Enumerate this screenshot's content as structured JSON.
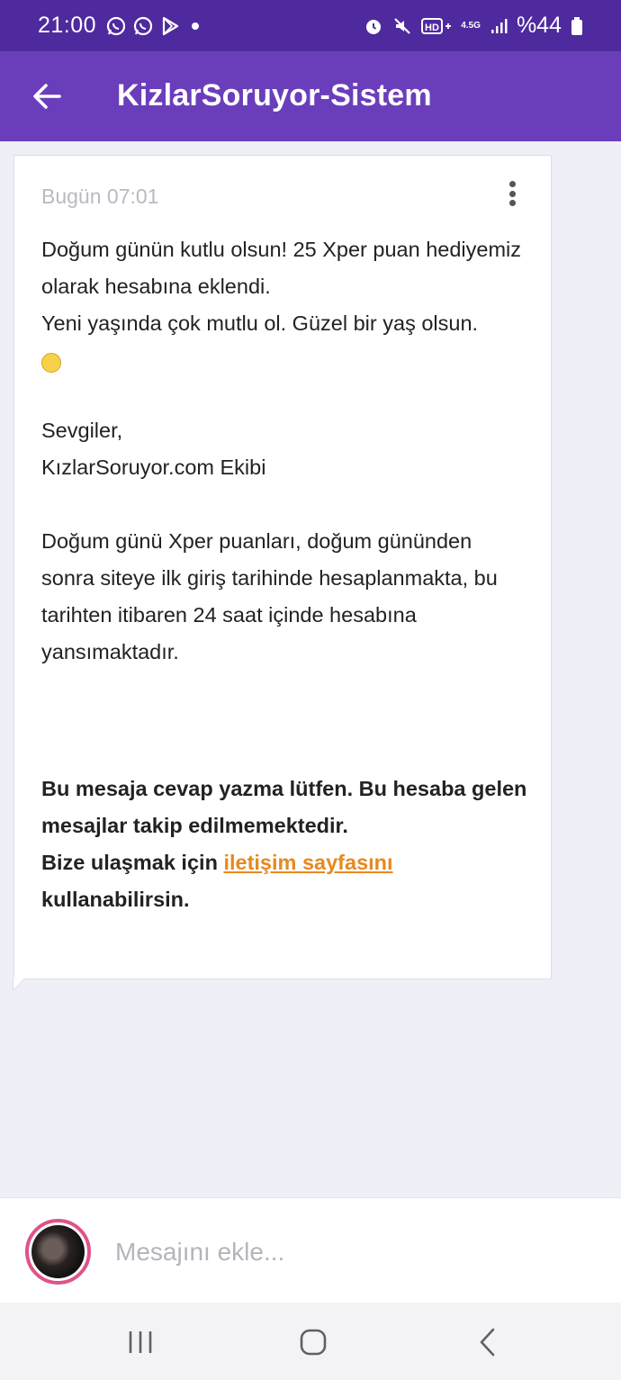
{
  "status_bar": {
    "time": "21:00",
    "battery": "%44",
    "network": "4.5G",
    "icons": [
      "whatsapp-icon",
      "whatsapp-icon",
      "play-store-icon",
      "dot-icon",
      "alarm-icon",
      "mute-icon",
      "hd-plus-icon",
      "network-4.5g-icon",
      "signal-icon",
      "battery-icon"
    ]
  },
  "app_bar": {
    "title": "KizlarSoruyor-Sistem",
    "back_icon": "arrow-left-icon"
  },
  "message": {
    "time": "Bugün 07:01",
    "menu_icon": "more-vertical-icon",
    "paragraph1": {
      "line1": "Doğum günün kutlu olsun! 25 Xper puan hediyemiz olarak hesabına eklendi.",
      "line2": "Yeni yaşında çok mutlu ol. Güzel bir yaş olsun.",
      "emoji": "smiling-face-emoji"
    },
    "signoff": {
      "line1": "Sevgiler,",
      "line2": "KızlarSoruyor.com Ekibi"
    },
    "paragraph2": "Doğum günü Xper puanları, doğum gününden sonra siteye ilk giriş tarihinde hesaplanmakta, bu tarihten itibaren 24 saat içinde hesabına yansımaktadır.",
    "notice": {
      "line1": "Bu mesaja cevap yazma lütfen. Bu hesaba gelen mesajlar takip edilmemektedir.",
      "line2_prefix": "Bize ulaşmak için",
      "link_text": "iletişim sayfasını",
      "line2_suffix": "kullanabilirsin."
    }
  },
  "composer": {
    "placeholder": "Mesajını ekle...",
    "avatar": "user-avatar"
  },
  "nav_bar": {
    "buttons": [
      "recent-apps-icon",
      "home-icon",
      "back-icon"
    ]
  },
  "colors": {
    "status_bar": "#4f2a9e",
    "app_bar": "#6a3ebb",
    "background": "#eeeff7",
    "link": "#e6891e",
    "avatar_ring": "#e0528a"
  }
}
